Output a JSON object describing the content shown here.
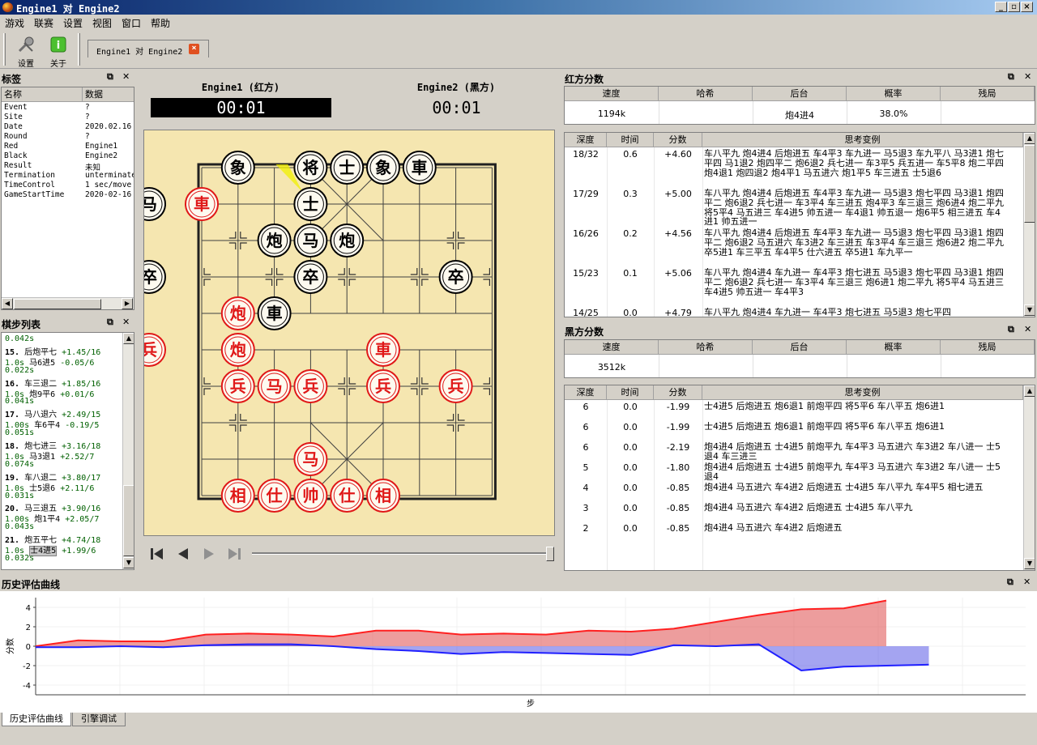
{
  "window": {
    "title": "Engine1 对 Engine2",
    "buttons": [
      "_",
      "▫",
      "×"
    ]
  },
  "menu": [
    "游戏",
    "联赛",
    "设置",
    "视图",
    "窗口",
    "帮助"
  ],
  "toolbar": {
    "settings_label": "设置",
    "about_label": "关于",
    "doc_tab": "Engine1 对 Engine2",
    "doc_tab_close": "×"
  },
  "tags": {
    "title": "标签",
    "col_name": "名称",
    "col_data": "数据",
    "rows": [
      {
        "k": "Event",
        "v": "?"
      },
      {
        "k": "Site",
        "v": "?"
      },
      {
        "k": "Date",
        "v": "2020.02.16"
      },
      {
        "k": "Round",
        "v": "?"
      },
      {
        "k": "Red",
        "v": "Engine1"
      },
      {
        "k": "Black",
        "v": "Engine2"
      },
      {
        "k": "Result",
        "v": "未知"
      },
      {
        "k": "Termination",
        "v": "unterminated"
      },
      {
        "k": "TimeControl",
        "v": "1 sec/move"
      },
      {
        "k": "GameStartTime",
        "v": "2020-02-16"
      }
    ]
  },
  "movelist": {
    "title": "棋步列表",
    "lines": [
      {
        "t": "0.042s",
        "cls": "g"
      },
      {
        "n": "15.",
        "m": "后炮平七",
        "e": "+1.45/16"
      },
      {
        "t": "1.0s",
        "m": "马6进5",
        "e": "-0.05/6",
        "black": true
      },
      {
        "t": "0.022s",
        "cls": "g"
      },
      {
        "n": "16.",
        "m": "车三退二",
        "e": "+1.85/16"
      },
      {
        "t": "1.0s",
        "m": "炮9平6",
        "e": "+0.01/6",
        "black": true
      },
      {
        "t": "0.041s",
        "cls": "g"
      },
      {
        "n": "17.",
        "m": "马八退六",
        "e": "+2.49/15"
      },
      {
        "t": "1.00s",
        "m": "车6平4",
        "e": "-0.19/5",
        "black": true
      },
      {
        "t": "0.051s",
        "cls": "g"
      },
      {
        "n": "18.",
        "m": "炮七进三",
        "e": "+3.16/18"
      },
      {
        "t": "1.0s",
        "m": "马3退1",
        "e": "+2.52/7",
        "black": true
      },
      {
        "t": "0.074s",
        "cls": "g"
      },
      {
        "n": "19.",
        "m": "车八退二",
        "e": "+3.80/17"
      },
      {
        "t": "1.0s",
        "m": "士5退6",
        "e": "+2.11/6",
        "black": true
      },
      {
        "t": "0.031s",
        "cls": "g"
      },
      {
        "n": "20.",
        "m": "马三退五",
        "e": "+3.90/16"
      },
      {
        "t": "1.00s",
        "m": "炮1平4",
        "e": "+2.05/7",
        "black": true
      },
      {
        "t": "0.043s",
        "cls": "g"
      },
      {
        "n": "21.",
        "m": "炮五平七",
        "e": "+4.74/18"
      },
      {
        "t": "1.0s",
        "m": "士4进5",
        "e": "+1.99/6",
        "black": true,
        "sel": true
      },
      {
        "t": "0.032s",
        "cls": "g"
      }
    ]
  },
  "players": {
    "red_name": "Engine1 (红方)",
    "red_clock": "00:01",
    "black_name": "Engine2 (黑方)",
    "black_clock": "00:01"
  },
  "board": {
    "pieces": [
      {
        "c": 1,
        "r": 0,
        "ch": "象",
        "s": "b"
      },
      {
        "c": 3,
        "r": 0,
        "ch": "将",
        "s": "b"
      },
      {
        "c": 4,
        "r": 0,
        "ch": "士",
        "s": "b"
      },
      {
        "c": 5,
        "r": 0,
        "ch": "象",
        "s": "b"
      },
      {
        "c": 6,
        "r": 0,
        "ch": "車",
        "s": "b"
      },
      {
        "c": -1,
        "r": 1,
        "ch": "马",
        "s": "b"
      },
      {
        "c": 0,
        "r": 1,
        "ch": "車",
        "s": "r"
      },
      {
        "c": 3,
        "r": 1,
        "ch": "士",
        "s": "b"
      },
      {
        "c": 2,
        "r": 2,
        "ch": "炮",
        "s": "b"
      },
      {
        "c": 3,
        "r": 2,
        "ch": "马",
        "s": "b"
      },
      {
        "c": 4,
        "r": 2,
        "ch": "炮",
        "s": "b"
      },
      {
        "c": -1,
        "r": 3,
        "ch": "卒",
        "s": "b"
      },
      {
        "c": 3,
        "r": 3,
        "ch": "卒",
        "s": "b"
      },
      {
        "c": 7,
        "r": 3,
        "ch": "卒",
        "s": "b"
      },
      {
        "c": 1,
        "r": 4,
        "ch": "炮",
        "s": "r"
      },
      {
        "c": 2,
        "r": 4,
        "ch": "車",
        "s": "b"
      },
      {
        "c": -1,
        "r": 5,
        "ch": "兵",
        "s": "r"
      },
      {
        "c": 1,
        "r": 5,
        "ch": "炮",
        "s": "r"
      },
      {
        "c": 5,
        "r": 5,
        "ch": "車",
        "s": "r"
      },
      {
        "c": 1,
        "r": 6,
        "ch": "兵",
        "s": "r"
      },
      {
        "c": 2,
        "r": 6,
        "ch": "马",
        "s": "r"
      },
      {
        "c": 3,
        "r": 6,
        "ch": "兵",
        "s": "r"
      },
      {
        "c": 5,
        "r": 6,
        "ch": "兵",
        "s": "r"
      },
      {
        "c": 7,
        "r": 6,
        "ch": "兵",
        "s": "r"
      },
      {
        "c": 3,
        "r": 8,
        "ch": "马",
        "s": "r"
      },
      {
        "c": 1,
        "r": 9,
        "ch": "相",
        "s": "r"
      },
      {
        "c": 2,
        "r": 9,
        "ch": "仕",
        "s": "r"
      },
      {
        "c": 3,
        "r": 9,
        "ch": "帅",
        "s": "r"
      },
      {
        "c": 4,
        "r": 9,
        "ch": "仕",
        "s": "r"
      },
      {
        "c": 5,
        "r": 9,
        "ch": "相",
        "s": "r"
      }
    ]
  },
  "red_score": {
    "title": "红方分数",
    "headers": [
      "速度",
      "哈希",
      "后台",
      "概率",
      "残局"
    ],
    "values": [
      "1194k",
      "",
      "炮4进4",
      "38.0%",
      ""
    ],
    "pv_headers": [
      "深度",
      "时间",
      "分数",
      "思考变例"
    ],
    "pv_rows": [
      {
        "d": "18/32",
        "t": "0.6",
        "s": "+4.60",
        "v": "车八平九 炮4进4 后炮进五 车4平3 车九进一 马5退3 车九平八 马3进1 炮七平四 马1退2 炮四平二 炮6退2 兵七进一 车3平5 兵五进一 车5平8 炮二平四 炮4退1 炮四退2 炮4平1 马五进六 炮1平5 车三进五 士5退6"
      },
      {
        "d": "17/29",
        "t": "0.3",
        "s": "+5.00",
        "v": "车八平九 炮4进4 后炮进五 车4平3 车九进一 马5退3 炮七平四 马3退1 炮四平二 炮6退2 兵七进一 车3平4 车三进五 炮4平3 车三退三 炮6进4 炮二平九 将5平4 马五进三 车4进5 帅五进一 车4退1 帅五退一 炮6平5 相三进五 车4进1 帅五进一"
      },
      {
        "d": "16/26",
        "t": "0.2",
        "s": "+4.56",
        "v": "车八平九 炮4进4 后炮进五 车4平3 车九进一 马5退3 炮七平四 马3退1 炮四平二 炮6退2 马五进六 车3进2 车三进五 车3平4 车三退三 炮6进2 炮二平九 卒5进1 车三平五 车4平5 仕六进五 卒5进1 车九平一"
      },
      {
        "d": "15/23",
        "t": "0.1",
        "s": "+5.06",
        "v": "车八平九 炮4进4 车九进一 车4平3 炮七进五 马5退3 炮七平四 马3退1 炮四平二 炮6退2 兵七进一 车3平4 车三退三 炮6进1 炮二平九 将5平4 马五进三 车4进5 帅五进一 车4平3"
      },
      {
        "d": "14/25",
        "t": "0.0",
        "s": "+4.79",
        "v": "车八平九 炮4进4 车九进一 车4平3 炮七进五 马5退3 炮七平四"
      }
    ]
  },
  "black_score": {
    "title": "黑方分数",
    "headers": [
      "速度",
      "哈希",
      "后台",
      "概率",
      "残局"
    ],
    "values": [
      "3512k",
      "",
      "",
      "",
      ""
    ],
    "pv_headers": [
      "深度",
      "时间",
      "分数",
      "思考变例"
    ],
    "pv_rows": [
      {
        "d": "6",
        "t": "0.0",
        "s": "-1.99",
        "v": "士4进5 后炮进五 炮6退1 前炮平四 将5平6 车八平五 炮6进1"
      },
      {
        "d": "6",
        "t": "0.0",
        "s": "-1.99",
        "v": "士4进5 后炮进五 炮6退1 前炮平四 将5平6 车八平五 炮6进1"
      },
      {
        "d": "6",
        "t": "0.0",
        "s": "-2.19",
        "v": "炮4进4 后炮进五 士4进5 前炮平九 车4平3 马五进六 车3进2 车八进一 士5退4 车三进三"
      },
      {
        "d": "5",
        "t": "0.0",
        "s": "-1.80",
        "v": "炮4进4 后炮进五 士4进5 前炮平九 车4平3 马五进六 车3进2 车八进一 士5退4"
      },
      {
        "d": "4",
        "t": "0.0",
        "s": "-0.85",
        "v": "炮4进4 马五进六 车4进2 后炮进五 士4进5 车八平九 车4平5 相七进五"
      },
      {
        "d": "3",
        "t": "0.0",
        "s": "-0.85",
        "v": "炮4进4 马五进六 车4进2 后炮进五 士4进5 车八平九"
      },
      {
        "d": "2",
        "t": "0.0",
        "s": "-0.85",
        "v": "炮4进4 马五进六 车4进2 后炮进五"
      }
    ]
  },
  "eval_chart": {
    "title": "历史评估曲线",
    "tabs": [
      "历史评估曲线",
      "引擎调试"
    ]
  },
  "chart_data": {
    "type": "area",
    "xlabel": "步",
    "ylabel": "分数",
    "ylim": [
      -5,
      5
    ],
    "yticks": [
      4,
      2,
      0,
      -2,
      -4
    ],
    "series": [
      {
        "color": "#ff2020",
        "values": [
          0.0,
          0.6,
          0.5,
          0.5,
          1.2,
          1.3,
          1.2,
          1.0,
          1.6,
          1.6,
          1.2,
          1.3,
          1.2,
          1.6,
          1.5,
          1.8,
          2.5,
          3.2,
          3.8,
          3.9,
          4.7
        ]
      },
      {
        "color": "#2020ff",
        "values": [
          -0.1,
          -0.1,
          0.0,
          -0.1,
          0.1,
          0.2,
          0.2,
          0.0,
          -0.3,
          -0.5,
          -0.8,
          -0.6,
          -0.7,
          -0.8,
          -0.9,
          0.1,
          0.0,
          0.2,
          -2.5,
          -2.1,
          -2.0,
          -1.9
        ]
      }
    ]
  },
  "colors": {
    "board_bg": "#f5e6b0",
    "red_piece": "#e01818",
    "black_piece": "#000000",
    "panel_bg": "#d4d0c8"
  }
}
